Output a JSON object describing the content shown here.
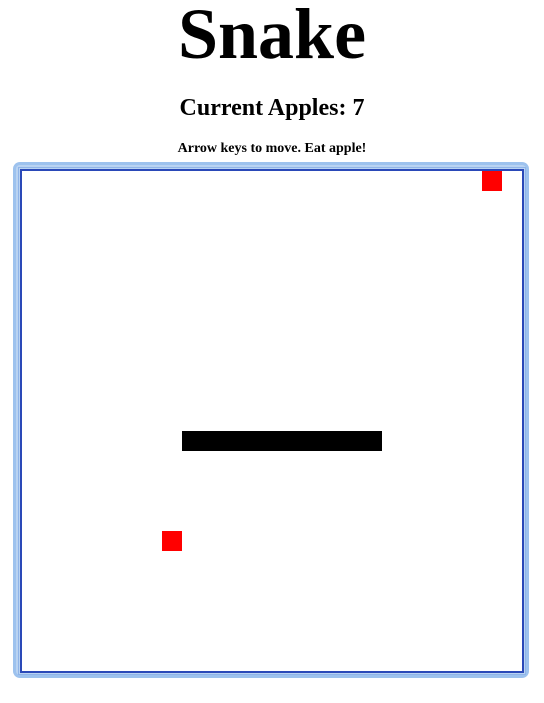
{
  "header": {
    "title": "Snake",
    "apples_label": "Current Apples: 7",
    "instructions": "Arrow keys to move. Eat apple!"
  },
  "game": {
    "apple_count": 7,
    "grid_cells": 25,
    "snake_color": "#000000",
    "apple_color": "#ff0000",
    "border_color": "#2a49b8",
    "snake": [
      {
        "col": 8,
        "row": 13
      },
      {
        "col": 9,
        "row": 13
      },
      {
        "col": 10,
        "row": 13
      },
      {
        "col": 11,
        "row": 13
      },
      {
        "col": 12,
        "row": 13
      },
      {
        "col": 13,
        "row": 13
      },
      {
        "col": 14,
        "row": 13
      },
      {
        "col": 15,
        "row": 13
      },
      {
        "col": 16,
        "row": 13
      },
      {
        "col": 17,
        "row": 13
      }
    ],
    "apples": [
      {
        "col": 23,
        "row": 0
      },
      {
        "col": 7,
        "row": 18
      }
    ]
  }
}
